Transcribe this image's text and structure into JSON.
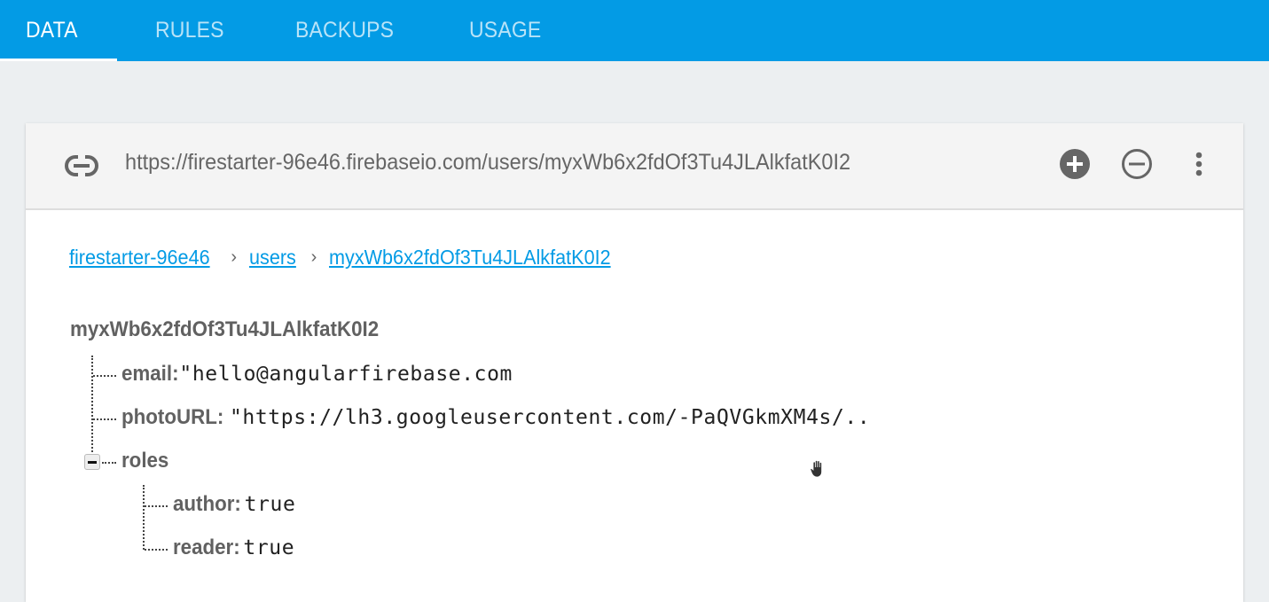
{
  "tabs": [
    {
      "label": "DATA",
      "active": true
    },
    {
      "label": "RULES",
      "active": false
    },
    {
      "label": "BACKUPS",
      "active": false
    },
    {
      "label": "USAGE",
      "active": false
    }
  ],
  "urlbar": {
    "icon": "link-icon",
    "url": "https://firestarter-96e46.firebaseio.com/users/myxWb6x2fdOf3Tu4JLAlkfatK0I2",
    "actions": [
      {
        "name": "add-child",
        "icon": "add-circle-icon"
      },
      {
        "name": "remove",
        "icon": "remove-circle-icon"
      },
      {
        "name": "more",
        "icon": "more-vert-icon"
      }
    ]
  },
  "breadcrumb": [
    {
      "label": "firestarter-96e46"
    },
    {
      "label": "users"
    },
    {
      "label": "myxWb6x2fdOf3Tu4JLAlkfatK0I2"
    }
  ],
  "breadcrumb_separator": "›",
  "tree": {
    "root": "myxWb6x2fdOf3Tu4JLAlkfatK0I2",
    "children": [
      {
        "key": "email:",
        "value": "\"hello@angularfirebase.com"
      },
      {
        "key": "photoURL:",
        "value": "\"https://lh3.googleusercontent.com/-PaQVGkmXM4s/.."
      },
      {
        "key": "roles",
        "expanded": true,
        "children": [
          {
            "key": "author:",
            "value": "true"
          },
          {
            "key": "reader:",
            "value": "true"
          }
        ]
      }
    ]
  },
  "colors": {
    "accent": "#039be5",
    "background": "#eceff1",
    "icon": "#666666"
  }
}
